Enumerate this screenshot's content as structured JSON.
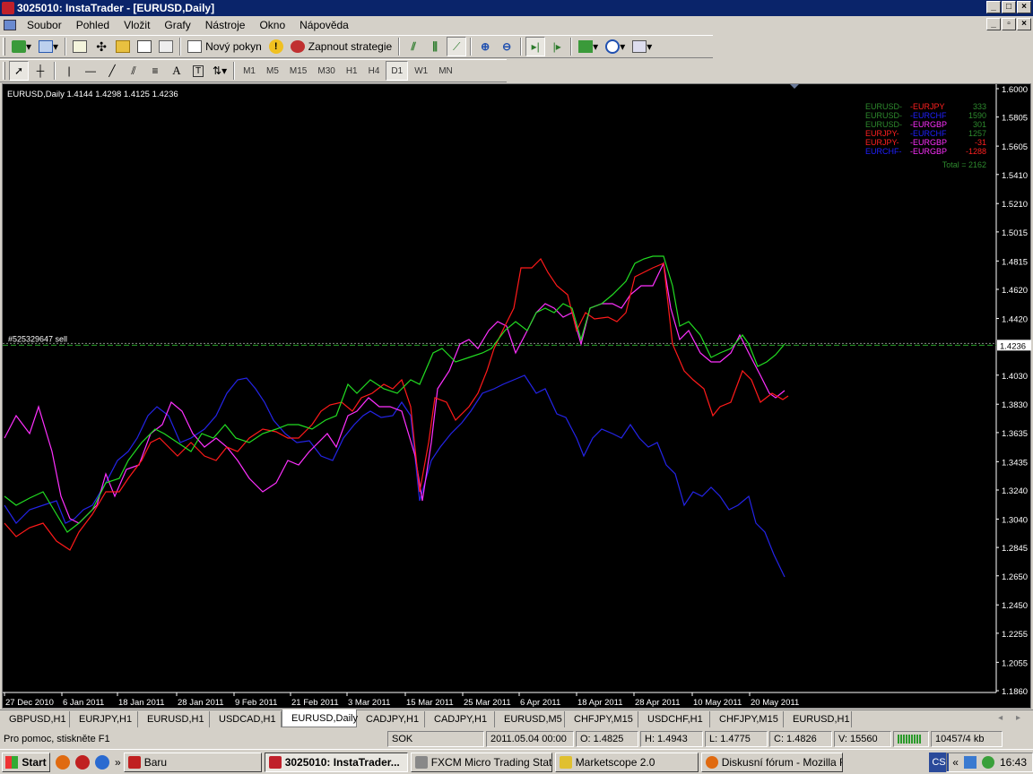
{
  "window": {
    "title": "3025010: InstaTrader - [EURUSD,Daily]"
  },
  "menu": [
    "Soubor",
    "Pohled",
    "Vložit",
    "Grafy",
    "Nástroje",
    "Okno",
    "Nápověda"
  ],
  "toolbar": {
    "new_order": "Nový pokyn",
    "strategies": "Zapnout strategie"
  },
  "timeframes": [
    "M1",
    "M5",
    "M15",
    "M30",
    "H1",
    "H4",
    "D1",
    "W1",
    "MN"
  ],
  "active_timeframe": "D1",
  "chart": {
    "info": "EURUSD,Daily  1.4144 1.4298 1.4125 1.4236",
    "order_label": "#525329647 sell",
    "current_price": "1.4236",
    "price_labels": [
      "1.6000",
      "1.5805",
      "1.5605",
      "1.5410",
      "1.5210",
      "1.5015",
      "1.4815",
      "1.4620",
      "1.4420",
      "1.4030",
      "1.3830",
      "1.3635",
      "1.3435",
      "1.3240",
      "1.3040",
      "1.2845",
      "1.2650",
      "1.2450",
      "1.2255",
      "1.2055",
      "1.1860"
    ],
    "date_labels": [
      "27 Dec 2010",
      "6 Jan 2011",
      "18 Jan 2011",
      "28 Jan 2011",
      "9 Feb 2011",
      "21 Feb 2011",
      "3 Mar 2011",
      "15 Mar 2011",
      "25 Mar 2011",
      "6 Apr 2011",
      "18 Apr 2011",
      "28 Apr 2011",
      "10 May 2011",
      "20 May 2011"
    ],
    "legend": [
      {
        "left": "EURUSD-",
        "right": "-EURJPY",
        "value": "333",
        "c1": "#2e8b2e",
        "c2": "#ff2020",
        "cv": "#2e8b2e"
      },
      {
        "left": "EURUSD-",
        "right": "-EURCHF",
        "value": "1590",
        "c1": "#2e8b2e",
        "c2": "#2020ff",
        "cv": "#2e8b2e"
      },
      {
        "left": "EURUSD-",
        "right": "-EURGBP",
        "value": "301",
        "c1": "#2e8b2e",
        "c2": "#ff30ff",
        "cv": "#2e8b2e"
      },
      {
        "left": "EURJPY-",
        "right": "-EURCHF",
        "value": "1257",
        "c1": "#ff2020",
        "c2": "#2020ff",
        "cv": "#2e8b2e"
      },
      {
        "left": "EURJPY-",
        "right": "-EURGBP",
        "value": "-31",
        "c1": "#ff2020",
        "c2": "#ff30ff",
        "cv": "#ff2020"
      },
      {
        "left": "EURCHF-",
        "right": "-EURGBP",
        "value": "-1288",
        "c1": "#2020ff",
        "c2": "#ff30ff",
        "cv": "#ff2020"
      }
    ],
    "total": "Total = 2162",
    "series_colors": {
      "green": "#22dd22",
      "red": "#ff1a1a",
      "magenta": "#ff30ff",
      "blue": "#2424e8"
    }
  },
  "tabs": [
    "GBPUSD,H1",
    "EURJPY,H1",
    "EURUSD,H1",
    "USDCAD,H1",
    "EURUSD,Daily",
    "CADJPY,H1",
    "CADJPY,H1",
    "EURUSD,M5",
    "CHFJPY,M15",
    "USDCHF,H1",
    "CHFJPY,M15",
    "EURUSD,H1"
  ],
  "active_tab": 4,
  "status": {
    "help": "Pro pomoc, stiskněte F1",
    "profile": "SOK",
    "datetime": "2011.05.04 00:00",
    "open": "O: 1.4825",
    "high": "H: 1.4943",
    "low": "L: 1.4775",
    "close": "C: 1.4826",
    "volume": "V: 15560",
    "traffic": "10457/4 kb"
  },
  "taskbar": {
    "start": "Start",
    "tasks": [
      "Baru",
      "3025010: InstaTrader...",
      "FXCM Micro Trading Stati...",
      "Marketscope 2.0",
      "Diskusní fórum - Mozilla F..."
    ],
    "lang": "CS",
    "clock": "16:43"
  }
}
